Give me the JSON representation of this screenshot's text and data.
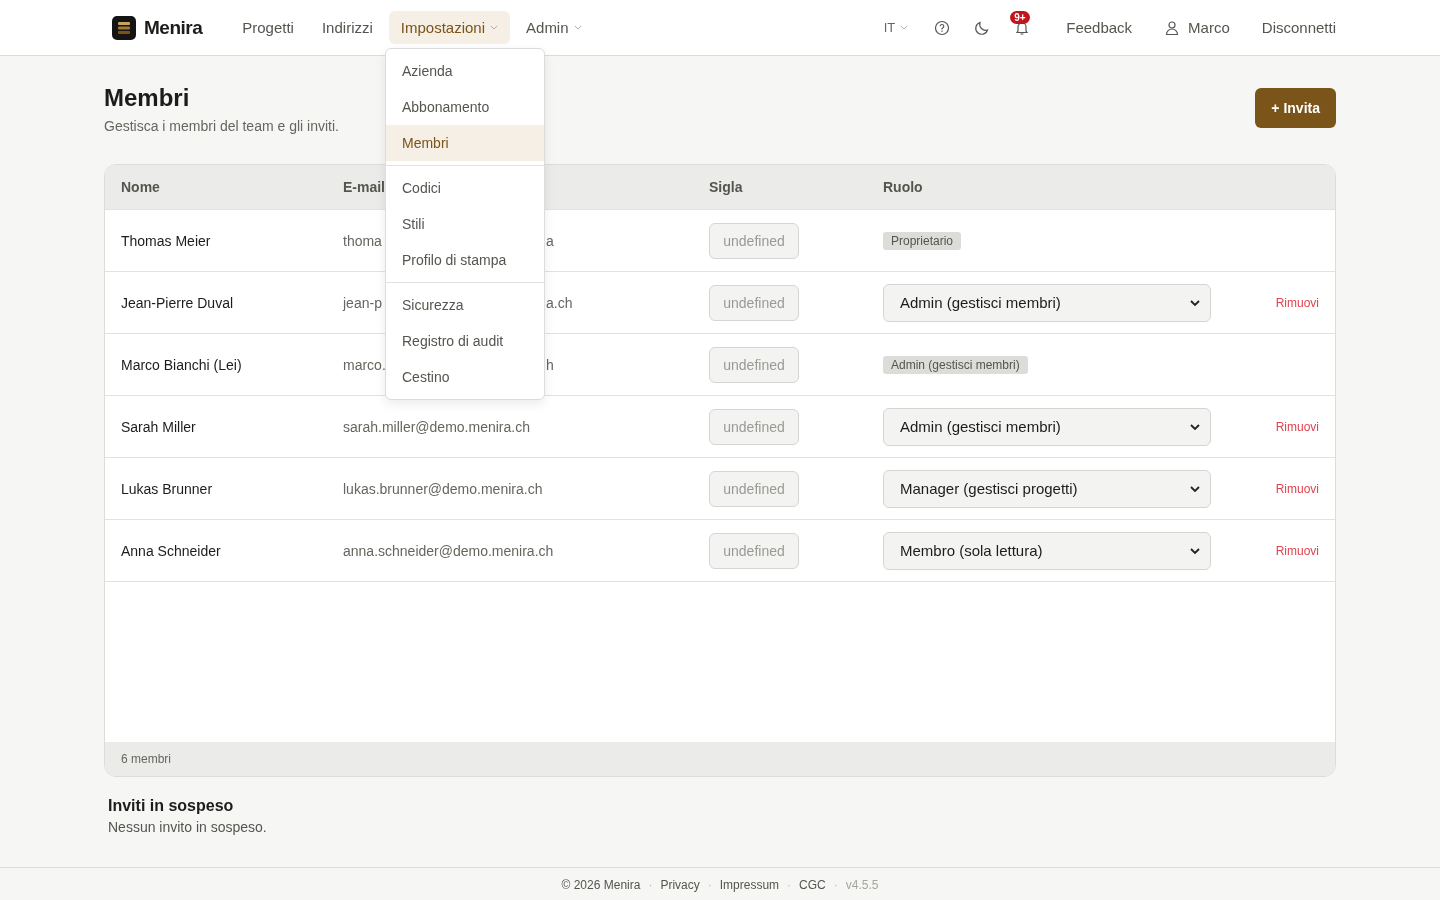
{
  "nav": {
    "brand": "Menira",
    "items": [
      {
        "label": "Progetti",
        "selected": false,
        "has_menu": false
      },
      {
        "label": "Indirizzi",
        "selected": false,
        "has_menu": false
      },
      {
        "label": "Impostazioni",
        "selected": true,
        "has_menu": true
      },
      {
        "label": "Admin",
        "selected": false,
        "has_menu": true
      }
    ],
    "language": "IT",
    "notification_badge": "9+",
    "feedback": "Feedback",
    "user": "Marco",
    "logout": "Disconnetti"
  },
  "menu": {
    "groups": [
      [
        {
          "label": "Azienda",
          "selected": false
        },
        {
          "label": "Abbonamento",
          "selected": false
        },
        {
          "label": "Membri",
          "selected": true
        }
      ],
      [
        {
          "label": "Codici",
          "selected": false
        },
        {
          "label": "Stili",
          "selected": false
        },
        {
          "label": "Profilo di stampa",
          "selected": false
        }
      ],
      [
        {
          "label": "Sicurezza",
          "selected": false
        },
        {
          "label": "Registro di audit",
          "selected": false
        },
        {
          "label": "Cestino",
          "selected": false
        }
      ]
    ]
  },
  "page": {
    "title": "Membri",
    "subtitle": "Gestisca i membri del team e gli inviti.",
    "invite_button": "+ Invita"
  },
  "table": {
    "columns": [
      "Nome",
      "E-mail",
      "Sigla",
      "Ruolo"
    ],
    "rows": [
      {
        "name": "Thomas Meier",
        "email_start": "thoma",
        "email_end": "a",
        "initials": "undefined",
        "role": {
          "kind": "badge",
          "label": "Proprietario"
        }
      },
      {
        "name": "Jean-Pierre Duval",
        "email_start": "jean-p",
        "email_end": "a.ch",
        "initials": "undefined",
        "role": {
          "kind": "select",
          "label": "Admin (gestisci membri)"
        },
        "action": "Rimuovi"
      },
      {
        "name": "Marco Bianchi (Lei)",
        "email_start": "marco.",
        "email_end": "h",
        "initials": "undefined",
        "role": {
          "kind": "badge",
          "label": "Admin (gestisci membri)"
        }
      },
      {
        "name": "Sarah Miller",
        "email_start": "sarah.miller@demo.menira.ch",
        "initials": "undefined",
        "role": {
          "kind": "select",
          "label": "Admin (gestisci membri)"
        },
        "action": "Rimuovi"
      },
      {
        "name": "Lukas Brunner",
        "email_start": "lukas.brunner@demo.menira.ch",
        "initials": "undefined",
        "role": {
          "kind": "select",
          "label": "Manager (gestisci progetti)"
        },
        "action": "Rimuovi"
      },
      {
        "name": "Anna Schneider",
        "email_start": "anna.schneider@demo.menira.ch",
        "initials": "undefined",
        "role": {
          "kind": "select",
          "label": "Membro (sola lettura)"
        },
        "action": "Rimuovi"
      }
    ],
    "footer": "6 membri"
  },
  "invites": {
    "title": "Inviti in sospeso",
    "empty": "Nessun invito in sospeso."
  },
  "footer": {
    "separator": "·",
    "copyright": "© 2026 Menira",
    "links": [
      "Privacy",
      "Impressum",
      "CGC"
    ],
    "version": "v4.5.5"
  }
}
